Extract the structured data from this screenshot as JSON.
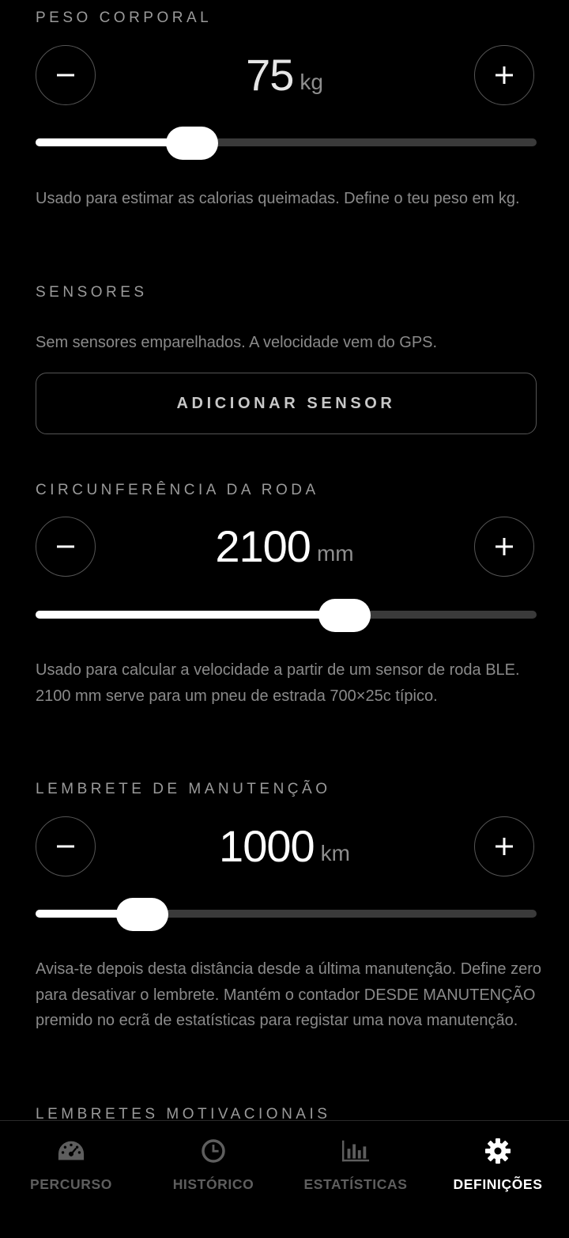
{
  "weight": {
    "title": "PESO CORPORAL",
    "value": "75",
    "unit": "kg",
    "slider_fraction": 0.29,
    "description": "Usado para estimar as calorias queimadas. Define o teu peso em kg."
  },
  "sensors": {
    "title": "SENSORES",
    "description": "Sem sensores emparelhados. A velocidade vem do GPS.",
    "add_button_label": "ADICIONAR SENSOR"
  },
  "wheel": {
    "title": "CIRCUNFERÊNCIA DA RODA",
    "value": "2100",
    "unit": "mm",
    "slider_fraction": 0.63,
    "description": "Usado para calcular a velocidade a partir de um sensor de roda BLE. 2100 mm serve para um pneu de estrada 700×25c típico."
  },
  "maintenance": {
    "title": "LEMBRETE DE MANUTENÇÃO",
    "value": "1000",
    "unit": "km",
    "slider_fraction": 0.18,
    "description": "Avisa-te depois desta distância desde a última manutenção. Define zero para desativar o lembrete. Mantém o contador DESDE MANUTENÇÃO premido no ecrã de estatísticas para registar uma nova manutenção."
  },
  "motivational": {
    "title": "LEMBRETES MOTIVACIONAIS"
  },
  "nav": {
    "items": [
      {
        "label": "PERCURSO",
        "icon": "speedometer-icon",
        "active": false
      },
      {
        "label": "HISTÓRICO",
        "icon": "clock-icon",
        "active": false
      },
      {
        "label": "ESTATÍSTICAS",
        "icon": "bar-chart-icon",
        "active": false
      },
      {
        "label": "DEFINIÇÕES",
        "icon": "gear-icon",
        "active": true
      }
    ]
  },
  "colors": {
    "background": "#000000",
    "accent": "#ffffff",
    "muted_text": "#8a8a8a",
    "track": "#3a3a3a"
  }
}
